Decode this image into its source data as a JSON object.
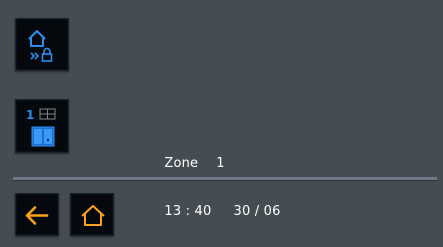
{
  "colors": {
    "background": "#464d52",
    "tile": "#05080d",
    "accent_blue": "#2a8ff0",
    "accent_orange": "#ffa21a",
    "divider": "#6e7a85"
  },
  "buttons": {
    "arm": {
      "icon": "house-lock-icon"
    },
    "zone": {
      "icon": "zone-door-icon",
      "number": "1"
    },
    "back": {
      "icon": "arrow-left-icon"
    },
    "home": {
      "icon": "home-icon"
    }
  },
  "status": {
    "zone_label": "Zone",
    "zone_number": "1",
    "time": "13 : 40",
    "date": "30 / 06"
  }
}
